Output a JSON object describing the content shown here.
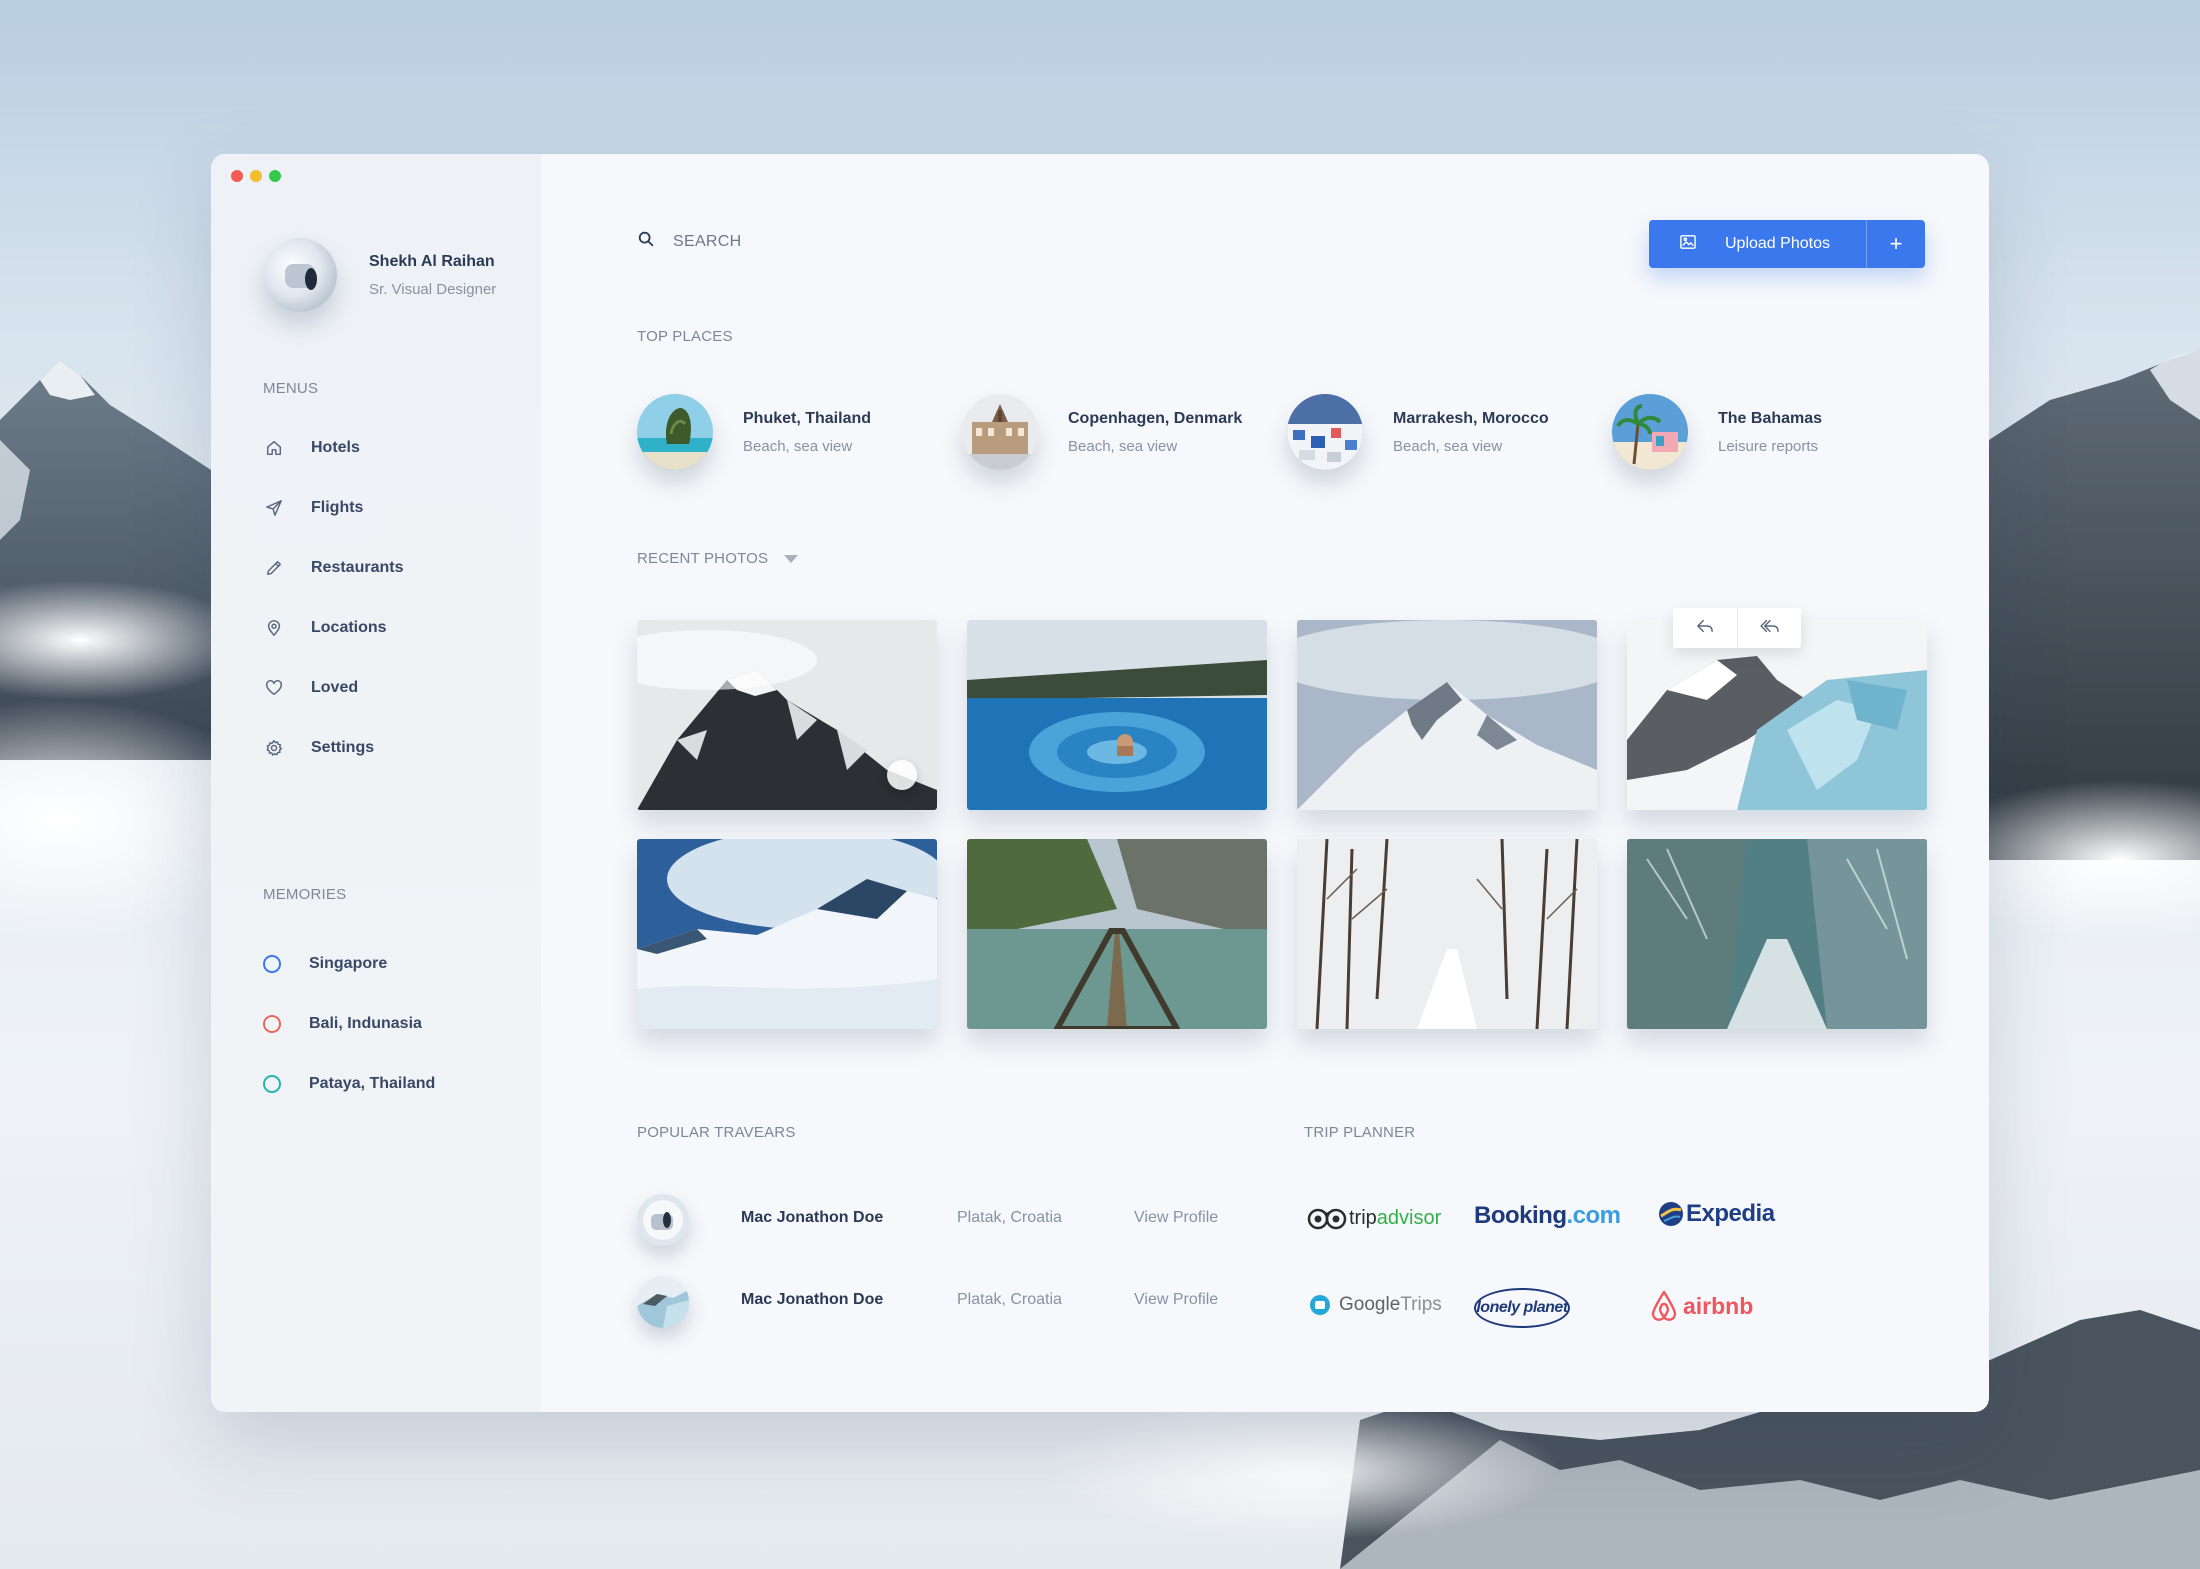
{
  "window": {
    "traffic_colors": [
      "#f35c55",
      "#f6bc2f",
      "#34c94a"
    ]
  },
  "profile": {
    "name": "Shekh Al Raihan",
    "role": "Sr. Visual Designer"
  },
  "sidebar": {
    "menus_label": "MENUS",
    "items": [
      {
        "label": "Hotels",
        "icon": "home-icon"
      },
      {
        "label": "Flights",
        "icon": "send-icon"
      },
      {
        "label": "Restaurants",
        "icon": "pencil-icon"
      },
      {
        "label": "Locations",
        "icon": "location-pin-icon"
      },
      {
        "label": "Loved",
        "icon": "heart-icon"
      },
      {
        "label": "Settings",
        "icon": "gear-icon"
      }
    ],
    "memories_label": "MEMORIES",
    "memories": [
      {
        "label": "Singapore",
        "color": "#3c78ed"
      },
      {
        "label": "Bali, Indunasia",
        "color": "#f0645a"
      },
      {
        "label": "Pataya, Thailand",
        "color": "#25b5b0"
      }
    ]
  },
  "search": {
    "placeholder": "SEARCH"
  },
  "upload": {
    "label": "Upload Photos",
    "plus": "+"
  },
  "top_places": {
    "label": "TOP PLACES",
    "items": [
      {
        "name": "Phuket, Thailand",
        "sub": "Beach, sea view"
      },
      {
        "name": "Copenhagen, Denmark",
        "sub": "Beach, sea view"
      },
      {
        "name": "Marrakesh, Morocco",
        "sub": "Beach, sea view"
      },
      {
        "name": "The Bahamas",
        "sub": "Leisure reports"
      }
    ]
  },
  "recent_photos": {
    "label": "RECENT PHOTOS"
  },
  "travelers": {
    "label": "POPULAR TRAVEARS",
    "rows": [
      {
        "name": "Mac Jonathon Doe",
        "location": "Platak, Croatia",
        "link": "View Profile"
      },
      {
        "name": "Mac Jonathon Doe",
        "location": "Platak, Croatia",
        "link": "View Profile"
      }
    ]
  },
  "trip_planner": {
    "label": "TRIP PLANNER",
    "logos": {
      "tripadvisor_a": "trip",
      "tripadvisor_b": "advisor",
      "booking_a": "Booking",
      "booking_b": ".com",
      "expedia": "Expedia",
      "google_a": "Google",
      "google_b": " Trips",
      "lonely": "lonely planet",
      "airbnb": "airbnb"
    }
  },
  "colors": {
    "accent": "#3c78ed",
    "text": "#2b3a55",
    "muted": "#8792a2"
  }
}
